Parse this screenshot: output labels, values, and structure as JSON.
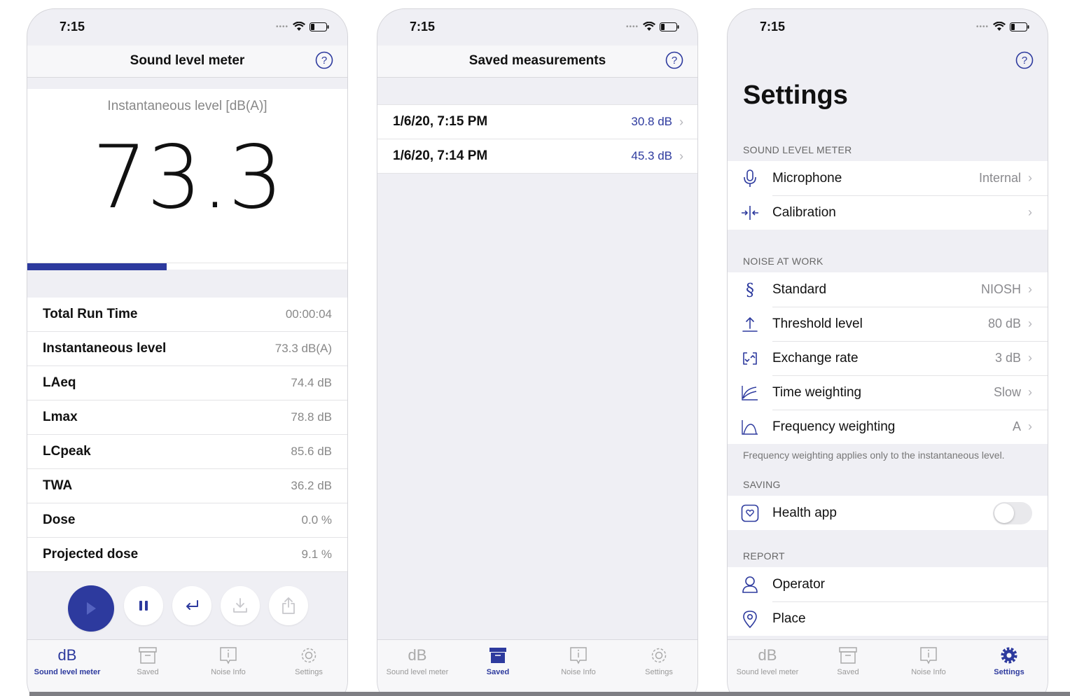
{
  "status": {
    "time": "7:15"
  },
  "screen1": {
    "title": "Sound level meter",
    "instantaneous_label": "Instantaneous level [dB(A)]",
    "instantaneous_value": "73.3",
    "level_fraction": 0.435,
    "stats": [
      {
        "label": "Total Run Time",
        "value": "00:00:04"
      },
      {
        "label": "Instantaneous level",
        "value": "73.3 dB(A)"
      },
      {
        "label": "LAeq",
        "value": "74.4 dB"
      },
      {
        "label": "Lmax",
        "value": "78.8 dB"
      },
      {
        "label": "LCpeak",
        "value": "85.6 dB"
      },
      {
        "label": "TWA",
        "value": "36.2 dB"
      },
      {
        "label": "Dose",
        "value": "0.0 %"
      },
      {
        "label": "Projected dose",
        "value": "9.1 %"
      }
    ],
    "controls": [
      "play-icon",
      "pause-icon",
      "return-icon",
      "download-icon",
      "share-icon"
    ]
  },
  "screen2": {
    "title": "Saved measurements",
    "measurements": [
      {
        "date": "1/6/20, 7:15 PM",
        "value": "30.8 dB"
      },
      {
        "date": "1/6/20, 7:14 PM",
        "value": "45.3 dB"
      }
    ]
  },
  "screen3": {
    "title": "Settings",
    "sections": {
      "sound_level_meter": "SOUND LEVEL METER",
      "noise_at_work": "NOISE AT WORK",
      "saving": "SAVING",
      "report": "REPORT"
    },
    "sound_level_meter": [
      {
        "label": "Microphone",
        "value": "Internal",
        "icon": "microphone-icon"
      },
      {
        "label": "Calibration",
        "value": "",
        "icon": "calibration-icon"
      }
    ],
    "noise_at_work": [
      {
        "label": "Standard",
        "value": "NIOSH",
        "icon": "section-sign-icon"
      },
      {
        "label": "Threshold level",
        "value": "80 dB",
        "icon": "threshold-icon"
      },
      {
        "label": "Exchange rate",
        "value": "3 dB",
        "icon": "exchange-icon"
      },
      {
        "label": "Time weighting",
        "value": "Slow",
        "icon": "time-weighting-icon"
      },
      {
        "label": "Frequency weighting",
        "value": "A",
        "icon": "frequency-weighting-icon"
      }
    ],
    "footnote": "Frequency weighting applies only to the instantaneous level.",
    "saving": [
      {
        "label": "Health app",
        "toggle": false,
        "icon": "health-icon"
      }
    ],
    "report": [
      {
        "label": "Operator",
        "icon": "person-icon"
      },
      {
        "label": "Place",
        "icon": "location-icon"
      }
    ]
  },
  "tabs": {
    "db_glyph": "dB",
    "items": [
      {
        "label": "Sound level meter",
        "icon": "db-icon"
      },
      {
        "label": "Saved",
        "icon": "archive-icon"
      },
      {
        "label": "Noise Info",
        "icon": "info-icon"
      },
      {
        "label": "Settings",
        "icon": "gear-icon"
      }
    ]
  },
  "colors": {
    "accent": "#2d3a9e",
    "background": "#efeff4",
    "secondary_text": "#888888"
  }
}
